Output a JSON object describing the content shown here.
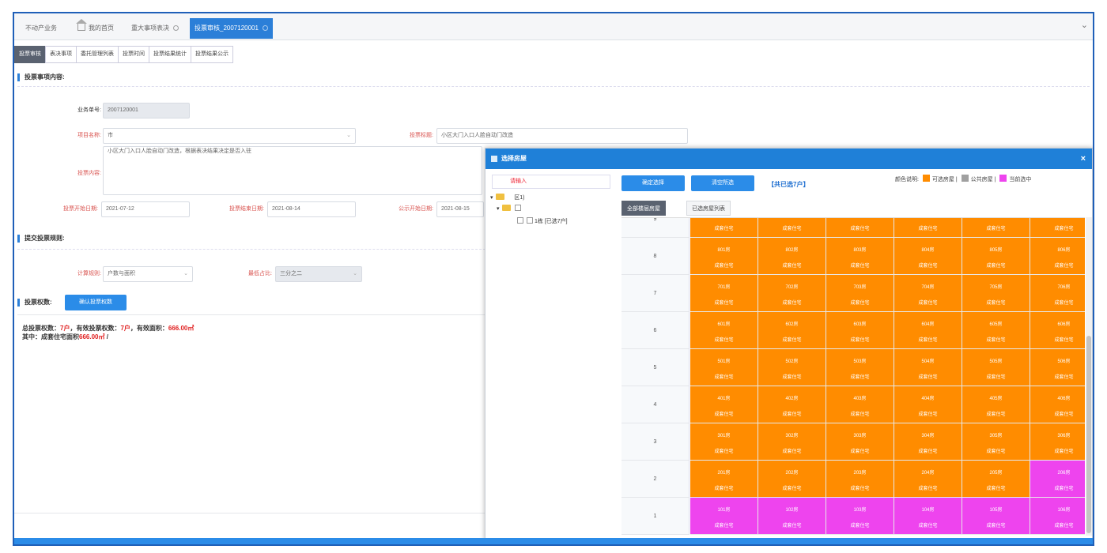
{
  "top_tabs": [
    {
      "label": "不动产业务",
      "active": false
    },
    {
      "label": "我的首页",
      "active": false
    },
    {
      "label": "重大事项表决",
      "active": false
    },
    {
      "label": "投票审核_2007120001",
      "active": true
    }
  ],
  "sub_tabs": [
    "投票审核",
    "表决事项",
    "委托管理列表",
    "投票时间",
    "投票结果统计",
    "投票结果公示"
  ],
  "section_vote_content": "投票事项内容:",
  "form": {
    "biz_no_label": "业务单号:",
    "biz_no": "2007120001",
    "project_label": "项目名称:",
    "project_value": "市",
    "topic_label": "投票标题:",
    "topic_value": "小区大门入口人脸自动门改造",
    "content_label": "投票内容:",
    "content_value": "小区大门入口人脸自动门改造，根据表决结果决定是否入驻",
    "start_label": "投票开始日期:",
    "start_date": "2021-07-12",
    "end_label": "投票结束日期:",
    "end_date": "2021-08-14",
    "pub_label": "公示开始日期:",
    "pub_date": "2021-08-15"
  },
  "section_rules": "提交投票规则:",
  "rules": {
    "calc_label": "计算规则:",
    "calc_value": "户数与面积",
    "ratio_label": "最低占比:",
    "ratio_value": "三分之二"
  },
  "section_rights": "投票权数:",
  "confirm_rights_button": "确认投票权数",
  "summary": {
    "line1_a": "总投票权数：",
    "total": "7户",
    "line1_b": "，有效投票权数：",
    "valid": "7户",
    "line1_c": "，有效面积：",
    "area": "666.00㎡",
    "line2_a": "其中：成套住宅面积",
    "area2": "666.00㎡",
    "line2_b": " /"
  },
  "modal": {
    "title": "选择房屋",
    "close": "×",
    "search_text": "请输入",
    "tree": {
      "root": "区1)",
      "child": "",
      "building": "1栋 [已选7户]"
    },
    "confirm_button": "确定选择",
    "clear_button": "清空所选",
    "selected_count": "【共已选7户】",
    "legend_title": "颜色说明:",
    "legend": [
      {
        "label": "可选房屋",
        "color": "#ff8c00"
      },
      {
        "label": "公共房屋",
        "color": "#a0a0a0"
      },
      {
        "label": "当前选中",
        "color": "#ee44ee"
      }
    ],
    "tab_all": "全部楼层房屋",
    "tab_selected": "已选房屋列表",
    "top_floor_label": "9",
    "unit_type": "成套住宅",
    "floors": [
      {
        "floor": "8",
        "units": [
          "801房",
          "802房",
          "803房",
          "804房",
          "805房",
          "806房"
        ],
        "selected": [
          false,
          false,
          false,
          false,
          false,
          false
        ]
      },
      {
        "floor": "7",
        "units": [
          "701房",
          "702房",
          "703房",
          "704房",
          "705房",
          "706房"
        ],
        "selected": [
          false,
          false,
          false,
          false,
          false,
          false
        ]
      },
      {
        "floor": "6",
        "units": [
          "601房",
          "602房",
          "603房",
          "604房",
          "605房",
          "606房"
        ],
        "selected": [
          false,
          false,
          false,
          false,
          false,
          false
        ]
      },
      {
        "floor": "5",
        "units": [
          "501房",
          "502房",
          "503房",
          "504房",
          "505房",
          "506房"
        ],
        "selected": [
          false,
          false,
          false,
          false,
          false,
          false
        ]
      },
      {
        "floor": "4",
        "units": [
          "401房",
          "402房",
          "403房",
          "404房",
          "405房",
          "406房"
        ],
        "selected": [
          false,
          false,
          false,
          false,
          false,
          false
        ]
      },
      {
        "floor": "3",
        "units": [
          "301房",
          "302房",
          "303房",
          "304房",
          "305房",
          "306房"
        ],
        "selected": [
          false,
          false,
          false,
          false,
          false,
          false
        ]
      },
      {
        "floor": "2",
        "units": [
          "201房",
          "202房",
          "203房",
          "204房",
          "205房",
          "206房"
        ],
        "selected": [
          false,
          false,
          false,
          false,
          false,
          true
        ]
      },
      {
        "floor": "1",
        "units": [
          "101房",
          "102房",
          "103房",
          "104房",
          "105房",
          "106房"
        ],
        "selected": [
          true,
          true,
          true,
          true,
          true,
          true
        ]
      }
    ],
    "colors": {
      "available": "#ff8c00",
      "selected": "#ee44ee",
      "public": "#a0a0a0"
    }
  }
}
